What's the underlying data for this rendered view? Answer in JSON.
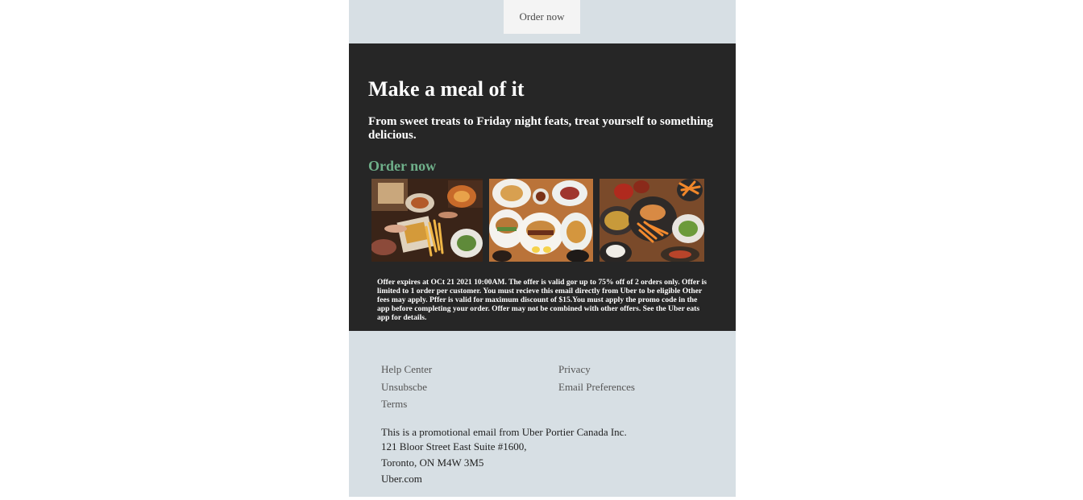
{
  "top_band": {
    "order_button_label": "Order now"
  },
  "hero": {
    "title": "Make a meal of it",
    "subtitle": "From sweet treats to Friday night feats, treat yourself to something delicious.",
    "cta_label": "Order now",
    "cta_color": "#6fb08a",
    "background_color": "#262626",
    "photos": [
      {
        "icon": "food-photo-takeout-table"
      },
      {
        "icon": "food-photo-burger-plates"
      },
      {
        "icon": "food-photo-fries-dishes"
      }
    ],
    "disclaimer": "Offer expires at OCt 21 2021 10:00AM. The offer is valid gor up to 75% off of 2 orders only. Offer is limited to 1 order per customer. You must recieve this email directly from Uber to be eligible Other fees may apply. Pffer is valid for maximum discount of $15.You must apply the promo code in the app before completing your order. Offer may not be combined with other offers. See the Uber eats app for details."
  },
  "footer": {
    "background_color": "#d7dfe4",
    "links": {
      "help_center": "Help Center",
      "privacy": "Privacy",
      "unsubscribe": "Unsubscbe",
      "email_preferences": "Email Preferences",
      "terms": "Terms"
    },
    "address": {
      "line1": "This is a promotional email from Uber Portier Canada Inc.",
      "line2": "121 Bloor Street East Suite #1600,",
      "line3": "Toronto, ON M4W 3M5",
      "website": "Uber.com"
    }
  }
}
